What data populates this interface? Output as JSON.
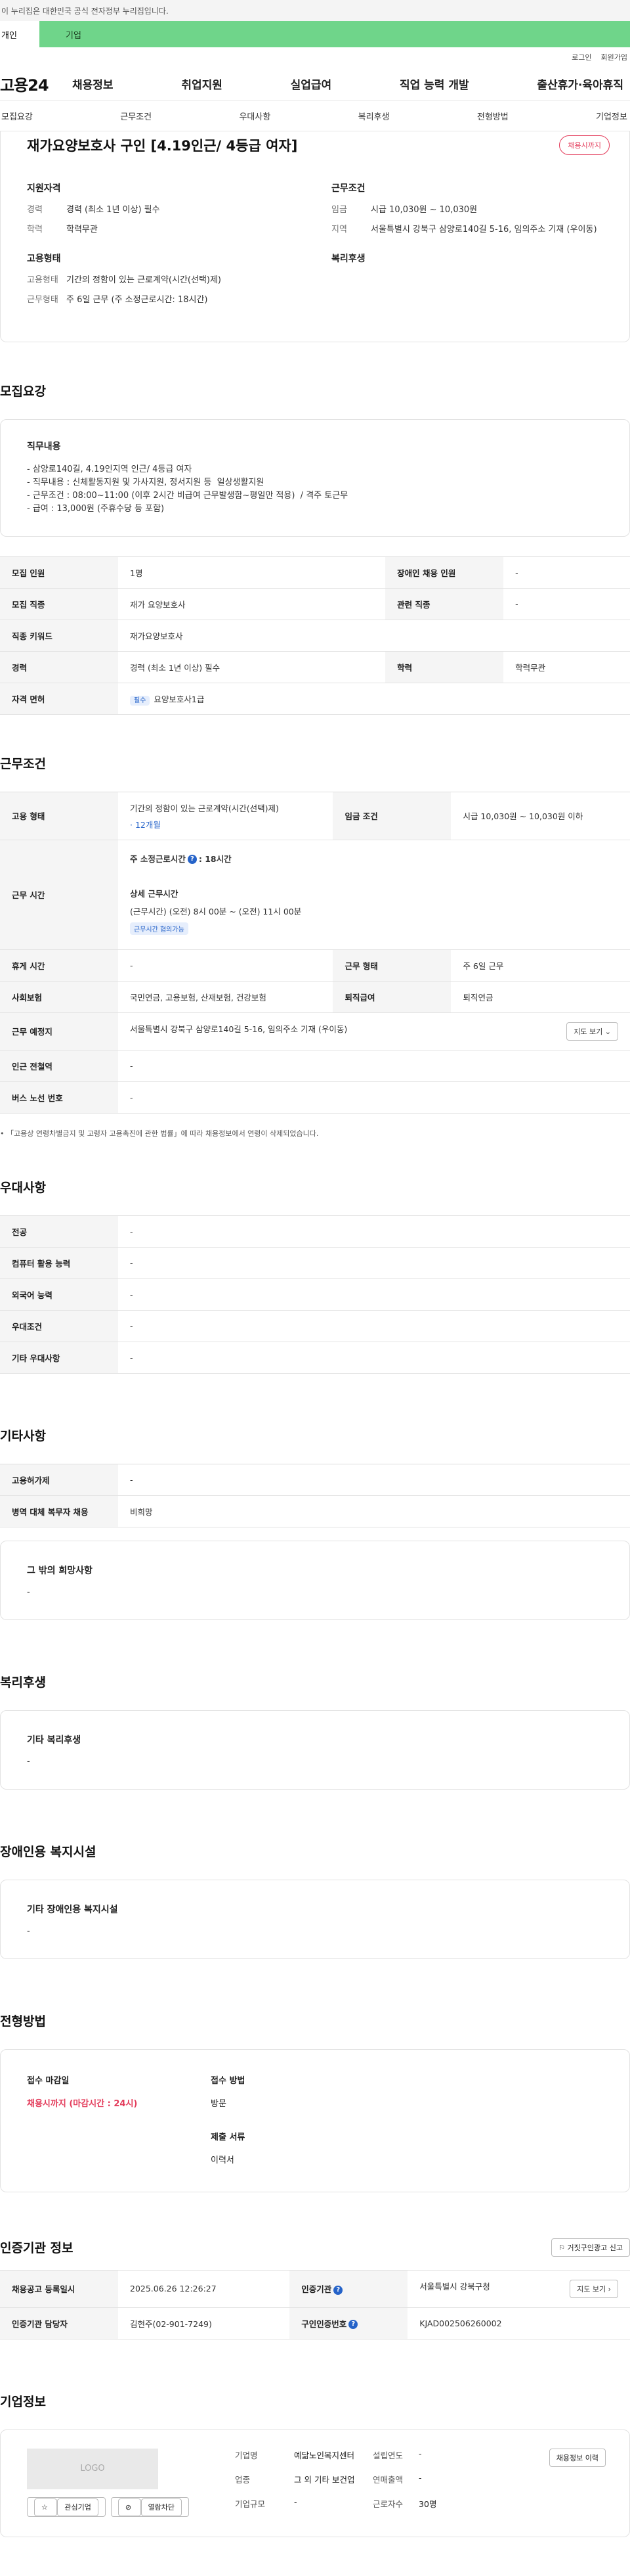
{
  "gov_notice": "이 누리집은 대한민국 공식 전자정부 누리집입니다.",
  "tabs": {
    "personal": "개인",
    "corporate": "기업"
  },
  "utility": {
    "login": "로그인",
    "join": "회원가입"
  },
  "logo": "고용24",
  "gnb": [
    "채용정보",
    "취업지원",
    "실업급여",
    "직업 능력 개발",
    "출산휴가·육아휴직"
  ],
  "subnav": [
    "모집요강",
    "근무조건",
    "우대사항",
    "복리후생",
    "전형방법",
    "기업정보"
  ],
  "summary": {
    "title": "재가요양보호사 구인 [4.19인근/ 4등급 여자]",
    "status": "채용시까지",
    "qual_title": "지원자격",
    "career_label": "경력",
    "career_value": "경력 (최소 1년 이상) 필수",
    "edu_label": "학력",
    "edu_value": "학력무관",
    "emp_title": "고용형태",
    "emp_label": "고용형태",
    "emp_value": "기간의 정함이 있는 근로계약(시간(선택)제)",
    "form_label": "근무형태",
    "form_value": "주 6일 근무 (주 소정근로시간: 18시간)",
    "work_title": "근무조건",
    "wage_label": "임금",
    "wage_value": "시급 10,030원 ~ 10,030원",
    "region_label": "지역",
    "region_value": "서울특별시 강북구 삼양로140길 5-16, 임의주소 기재 (우이동)",
    "welfare_title": "복리후생"
  },
  "recruit": {
    "section": "모집요강",
    "duty_title": "직무내용",
    "duty_text": "- 삼양로140길, 4.19인지역 인근/ 4등급 여자\n- 직무내용 : 신체활동지원 및 가사지원, 정서지원 등  일상생활지원\n- 근무조건 : 08:00~11:00 (이후 2시간 비급여 근무발생함~평일만 적용)  / 격주 토근무\n- 급여 : 13,000원 (주휴수당 등 포함)",
    "headcount_label": "모집 인원",
    "headcount": "1명",
    "disabled_label": "장애인 채용 인원",
    "disabled": "-",
    "job_label": "모집 직종",
    "job": "재가 요양보호사",
    "related_label": "관련 직종",
    "related": "-",
    "keyword_label": "직종 키워드",
    "keyword": "재가요양보호사",
    "career_label": "경력",
    "career": "경력 (최소 1년 이상) 필수",
    "edu_label": "학력",
    "edu": "학력무관",
    "license_label": "자격 면허",
    "license_badge": "필수",
    "license": "요양보호사1급"
  },
  "work": {
    "section": "근무조건",
    "emp_label": "고용 형태",
    "emp": "기간의 정함이 있는 근로계약(시간(선택)제)",
    "emp_period": "· 12개월",
    "wage_label": "임금 조건",
    "wage": "시급 10,030원 ~ 10,030원 이하",
    "hours_label": "근무 시간",
    "weekly_label": "주 소정근로시간",
    "weekly_value": ": 18시간",
    "detail_title": "상세 근무시간",
    "detail": "(근무시간) (오전) 8시 00분 ~ (오전) 11시 00분",
    "detail_badge": "근무시간 협의가능",
    "break_label": "휴게 시간",
    "break": "-",
    "shift_label": "근무 형태",
    "shift": "주 6일 근무",
    "insurance_label": "사회보험",
    "insurance": "국민연금, 고용보험, 산재보험, 건강보험",
    "retire_label": "퇴직급여",
    "retire": "퇴직연금",
    "place_label": "근무 예정지",
    "place": "서울특별시 강북구 삼양로140길 5-16, 임의주소 기재 (우이동)",
    "map_btn": "지도 보기",
    "subway_label": "인근 전철역",
    "subway": "-",
    "bus_label": "버스 노선 번호",
    "bus": "-",
    "footnote": "「고용상 연령차별금지 및 고령자 고용촉진에 관한 법률」에 따라 채용정보에서 연령이 삭제되었습니다."
  },
  "pref": {
    "section": "우대사항",
    "rows": [
      {
        "label": "전공",
        "value": "-"
      },
      {
        "label": "컴퓨터 활용 능력",
        "value": "-"
      },
      {
        "label": "외국어 능력",
        "value": "-"
      },
      {
        "label": "우대조건",
        "value": "-"
      },
      {
        "label": "기타 우대사항",
        "value": "-"
      }
    ]
  },
  "etc": {
    "section": "기타사항",
    "ins_label": "고용허가제",
    "ins": "-",
    "mil_label": "병역 대체 복무자 채용",
    "mil": "비희망",
    "wish_title": "그 밖의 희망사항",
    "wish": "-"
  },
  "welfare": {
    "section": "복리후생",
    "title": "기타 복리후생",
    "value": "-"
  },
  "facility": {
    "section": "장애인용 복지시설",
    "title": "기타 장애인용 복지시설",
    "value": "-"
  },
  "method": {
    "section": "전형방법",
    "deadline_label": "접수 마감일",
    "deadline": "채용시까지 (마감시간 : 24시)",
    "apply_label": "접수 방법",
    "apply": "방문",
    "docs_label": "제출 서류",
    "docs": "이력서"
  },
  "cert": {
    "section": "인증기관 정보",
    "report_btn": "거짓구인광고 신고",
    "reg_label": "채용공고 등록일시",
    "reg": "2025.06.26 12:26:27",
    "org_label": "인증기관",
    "org": "서울특별시 강북구청",
    "map_btn": "지도 보기",
    "mgr_label": "인증기관 담당자",
    "mgr": "김현주(02-901-7249)",
    "no_label": "구인인증번호",
    "no": "KJAD002506260002"
  },
  "company": {
    "section": "기업정보",
    "logo": "LOGO",
    "fav_btn": "관심기업",
    "block_btn": "열람차단",
    "name_label": "기업명",
    "name": "예닮노인복지센터",
    "found_label": "설립연도",
    "found": "-",
    "industry_label": "업종",
    "industry": "그 외 기타 보건업",
    "revenue_label": "연매출액",
    "revenue": "-",
    "size_label": "기업규모",
    "size": "-",
    "staff_label": "근로자수",
    "staff": "30명",
    "history_btn": "채용정보 이력"
  }
}
